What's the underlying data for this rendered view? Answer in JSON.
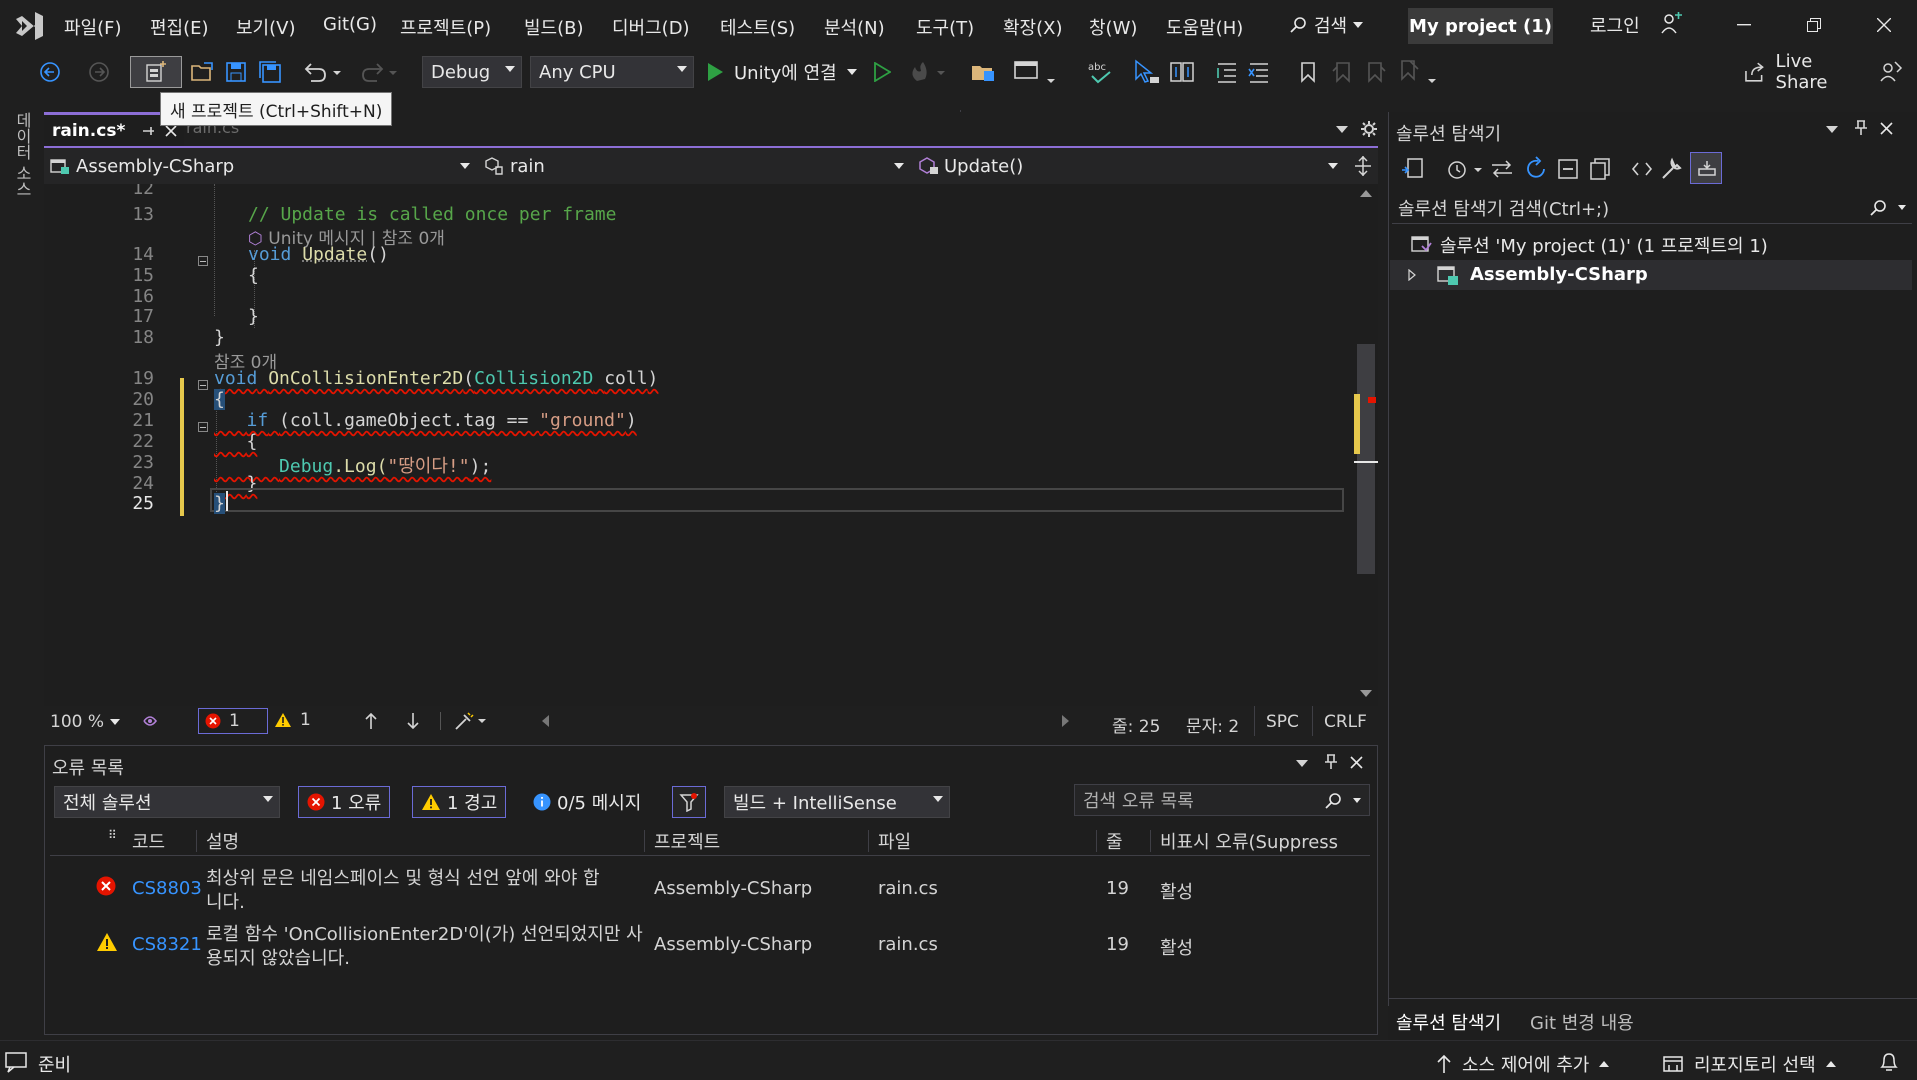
{
  "titlebar": {
    "menus": [
      "파일(F)",
      "편집(E)",
      "보기(V)",
      "Git(G)",
      "프로젝트(P)",
      "빌드(B)",
      "디버그(D)",
      "테스트(S)",
      "분석(N)",
      "도구(T)",
      "확장(X)",
      "창(W)",
      "도움말(H)"
    ],
    "search_label": "검색",
    "project_name": "My project (1)",
    "login_label": "로그인"
  },
  "toolbar": {
    "config": "Debug",
    "platform": "Any CPU",
    "run_label": "Unity에 연결",
    "live_share": "Live Share",
    "tooltip": "새 프로젝트 (Ctrl+Shift+N)"
  },
  "left_strip": {
    "label": "데이터 소스"
  },
  "editor": {
    "tab_active": "rain.cs*",
    "tab_inactive": "rain.cs",
    "nav_project": "Assembly-CSharp",
    "nav_class": "rain",
    "nav_member": "Update()",
    "codelens_update": "Unity 메시지 | 참조 0개",
    "codelens_collision": "참조 0개",
    "line_numbers": [
      "12",
      "13",
      "14",
      "15",
      "16",
      "17",
      "18",
      "19",
      "20",
      "21",
      "22",
      "23",
      "24",
      "25"
    ],
    "code": {
      "comment": "// Update is called once per frame",
      "kw_void": "void",
      "fn_update": "Update",
      "parens": "()",
      "brace_open": "{",
      "brace_close": "}",
      "fn_collision": "OnCollisionEnter2D",
      "type_collision": "Collision2D",
      "param": "coll",
      "if_kw": "if",
      "if_expr": "(coll.gameObject.tag == ",
      "str_ground": "\"ground\"",
      "close_paren": ")",
      "debug_cls": "Debug",
      "log_fn": ".Log(",
      "str_msg": "\"땅이다!\"",
      "end_stmt": ");"
    }
  },
  "editor_status": {
    "zoom": "100 %",
    "errors": "1",
    "warnings": "1",
    "line": "줄: 25",
    "char": "문자: 2",
    "spc": "SPC",
    "crlf": "CRLF"
  },
  "error_list": {
    "title": "오류 목록",
    "scope": "전체 솔루션",
    "errors_pill": "1 오류",
    "warnings_pill": "1 경고",
    "messages_pill": "0/5 메시지",
    "source": "빌드 + IntelliSense",
    "search_placeholder": "검색 오류 목록",
    "columns": [
      "코드",
      "설명",
      "프로젝트",
      "파일",
      "줄",
      "비표시 오류(Suppress"
    ],
    "rows": [
      {
        "type": "error",
        "code": "CS8803",
        "desc1": "최상위 문은 네임스페이스 및 형식 선언 앞에 와야 합",
        "desc2": "니다.",
        "project": "Assembly-CSharp",
        "file": "rain.cs",
        "line": "19",
        "state": "활성"
      },
      {
        "type": "warning",
        "code": "CS8321",
        "desc1": "로컬 함수 'OnCollisionEnter2D'이(가) 선언되었지만 사",
        "desc2": "용되지 않았습니다.",
        "project": "Assembly-CSharp",
        "file": "rain.cs",
        "line": "19",
        "state": "활성"
      }
    ]
  },
  "solution_explorer": {
    "title": "솔루션 탐색기",
    "search_placeholder": "솔루션 탐색기 검색(Ctrl+;)",
    "solution_label": "솔루션 'My project (1)' (1 프로젝트의 1)",
    "project_label": "Assembly-CSharp",
    "tab_active": "솔루션 탐색기",
    "tab_inactive": "Git 변경 내용"
  },
  "statusbar": {
    "ready": "준비",
    "source_control": "소스 제어에 추가",
    "repo": "리포지토리 선택"
  },
  "colors": {
    "accent": "#8c6ed6",
    "error": "#e51400",
    "warning": "#ffcc00",
    "link": "#3794ff"
  }
}
